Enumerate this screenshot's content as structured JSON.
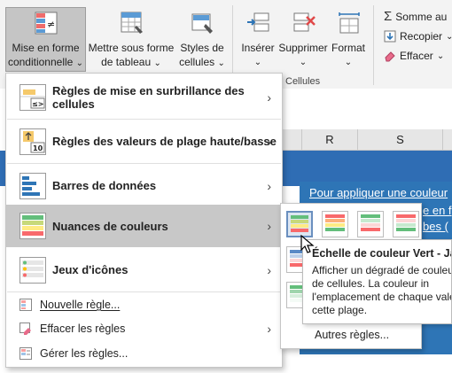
{
  "ribbon": {
    "cond_format": {
      "line1": "Mise en forme",
      "line2": "conditionnelle",
      "chev": "⌄"
    },
    "format_table": {
      "line1": "Mettre sous forme",
      "line2": "de tableau",
      "chev": "⌄"
    },
    "cell_styles": {
      "line1": "Styles de",
      "line2": "cellules",
      "chev": "⌄"
    },
    "insert": {
      "label": "Insérer",
      "chev": "⌄"
    },
    "delete": {
      "label": "Supprimer",
      "chev": "⌄"
    },
    "format": {
      "label": "Format",
      "chev": "⌄"
    },
    "cells_group": "Cellules",
    "autosum": "Somme au",
    "fill": "Recopier",
    "fill_chev": "⌄",
    "clear": "Effacer",
    "clear_chev": "⌄"
  },
  "sheet": {
    "col_r": "R",
    "col_s": "S"
  },
  "menu": {
    "items": [
      {
        "label": "Règles de mise en surbrillance des cellules",
        "chev": "›"
      },
      {
        "label": "Règles des valeurs de plage haute/basse",
        "chev": "›"
      },
      {
        "label": "Barres de données",
        "chev": "›"
      },
      {
        "label": "Nuances de couleurs",
        "chev": "›"
      },
      {
        "label": "Jeux d'icônes",
        "chev": "›"
      }
    ],
    "small": [
      {
        "label": "Nouvelle règle..."
      },
      {
        "label": "Effacer les règles",
        "chev": "›"
      },
      {
        "label": "Gérer les règles..."
      }
    ],
    "icon_text_1": "≤>",
    "icon_text_2": "10"
  },
  "submenu": {
    "more": "Autres règles..."
  },
  "bluebox": {
    "line1": "Pour appliquer une couleur",
    "line2": "e en f",
    "line3": "bes ("
  },
  "tooltip": {
    "title": "Échelle de couleur Vert - Jau",
    "body": "Afficher un dégradé de couleu plage de cellules. La couleur in l'emplacement de chaque vale dans cette plage."
  },
  "colors": {
    "accent": "#2e75b6",
    "highlight": "#c8c8c8",
    "green": "#63be7b",
    "yellow": "#ffeb84",
    "red": "#f8696b"
  }
}
